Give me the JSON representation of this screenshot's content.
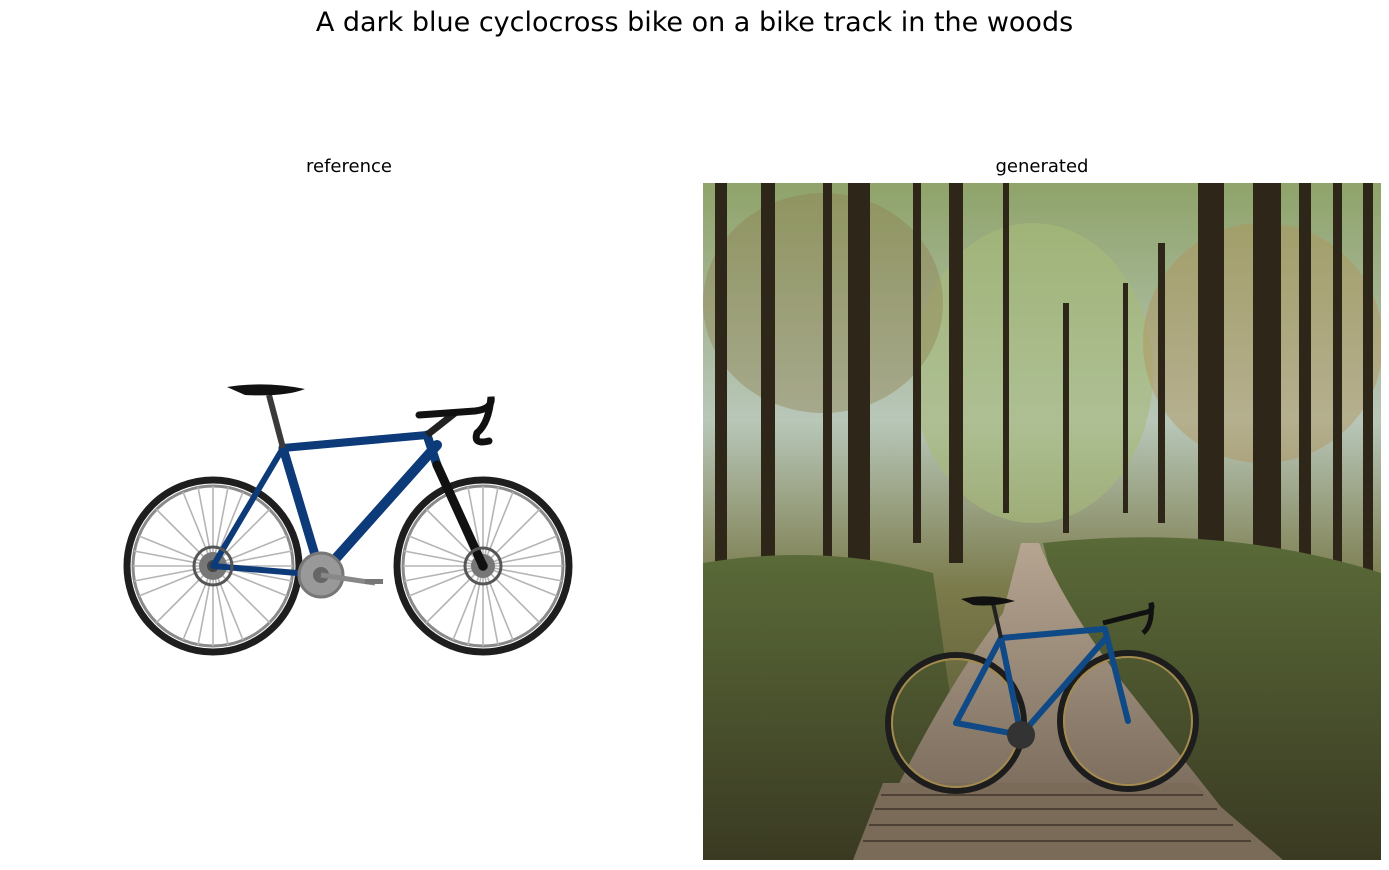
{
  "figure": {
    "title": "A dark blue cyclocross bike on a bike track in the woods"
  },
  "panels": [
    {
      "title": "reference"
    },
    {
      "title": "generated"
    }
  ],
  "colors": {
    "frame_blue": "#0d3a78",
    "tire": "#2a2a2a",
    "forest_dark": "#3b3322",
    "forest_green": "#7c8f4a",
    "path": "#8b7d6e",
    "boardwalk": "#6f6050",
    "sky": "#bcd0dc"
  }
}
